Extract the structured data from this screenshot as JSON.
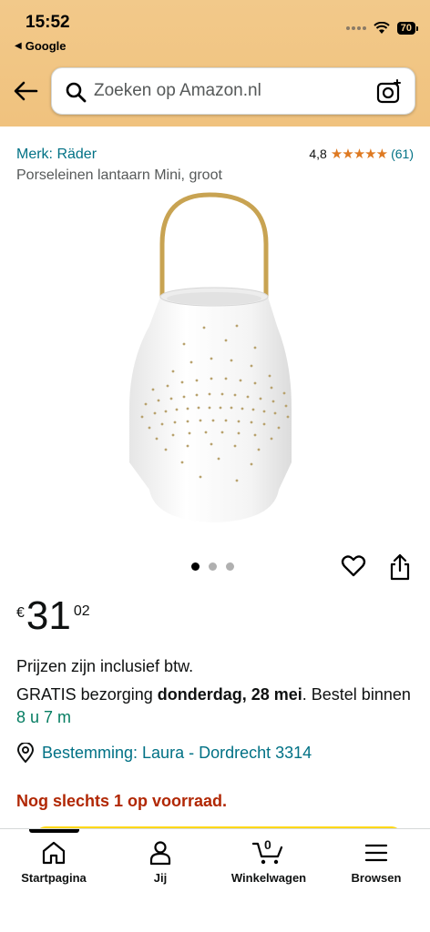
{
  "status_bar": {
    "time": "15:52",
    "back_app": "Google",
    "battery": "70"
  },
  "search": {
    "placeholder": "Zoeken op Amazon.nl"
  },
  "product": {
    "brand_link": "Merk: Räder",
    "title": "Porseleinen lantaarn Mini, groot",
    "rating_value": "4,8",
    "stars_filled": 4.8,
    "rating_count": "(61)",
    "image_count": 3,
    "image_active_index": 0
  },
  "price": {
    "currency": "€",
    "whole": "31",
    "fraction": "02"
  },
  "details": {
    "tax_note": "Prijzen zijn inclusief btw.",
    "delivery_prefix": "GRATIS bezorging ",
    "delivery_date": "donderdag, 28 mei",
    "delivery_mid": ". Bestel binnen ",
    "delivery_countdown": "8 u 7 m",
    "location": "Bestemming: Laura - Dordrecht 3314",
    "stock": "Nog slechts 1 op voorraad."
  },
  "bottom_nav": {
    "home": "Startpagina",
    "you": "Jij",
    "cart": "Winkelwagen",
    "cart_count": "0",
    "browse": "Browsen"
  },
  "colors": {
    "header_bg": "#f0c27e",
    "link": "#007185",
    "star": "#de7921",
    "stock": "#b12704",
    "countdown": "#067d62"
  }
}
